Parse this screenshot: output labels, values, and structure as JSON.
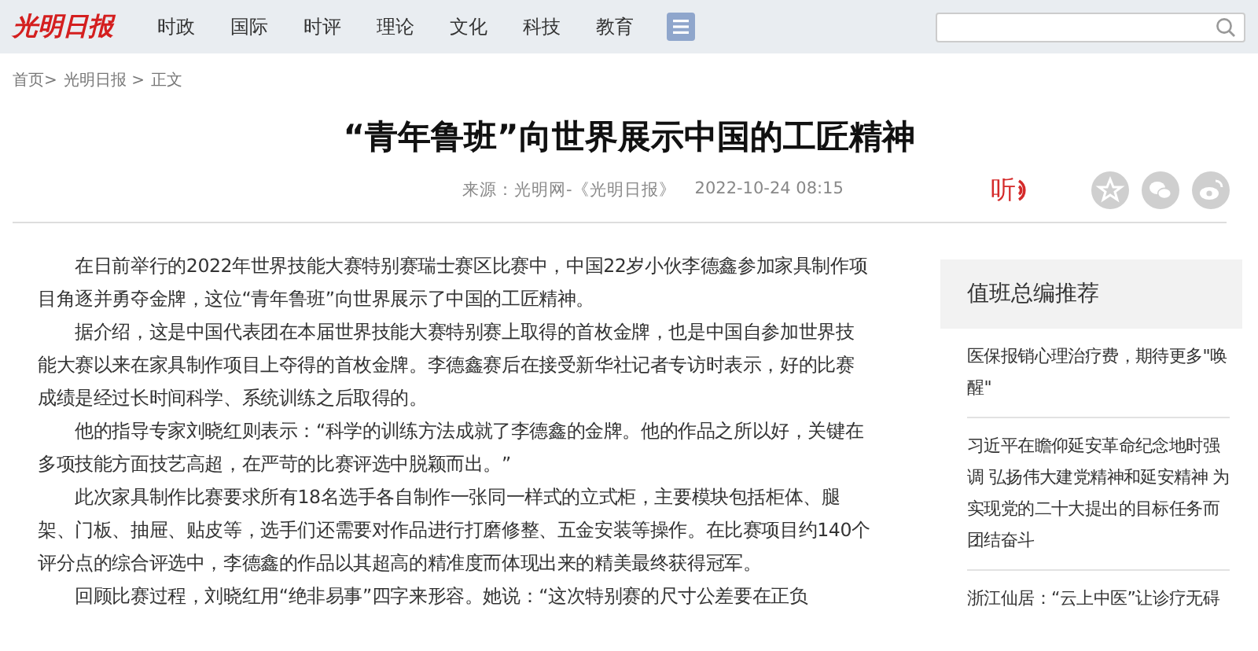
{
  "header": {
    "logo": "光明日报",
    "nav": [
      "时政",
      "国际",
      "时评",
      "理论",
      "文化",
      "科技",
      "教育"
    ]
  },
  "breadcrumb": [
    "首页>",
    "光明日报 >",
    "正文"
  ],
  "article": {
    "title": "“青年鲁班”向世界展示中国的工匠精神",
    "source": "来源：光明网-《光明日报》",
    "date": "2022-10-24 08:15",
    "listen_label": "听",
    "paragraphs": [
      "在日前举行的2022年世界技能大赛特别赛瑞士赛区比赛中，中国22岁小伙李德鑫参加家具制作项目角逐并勇夺金牌，这位“青年鲁班”向世界展示了中国的工匠精神。",
      "据介绍，这是中国代表团在本届世界技能大赛特别赛上取得的首枚金牌，也是中国自参加世界技能大赛以来在家具制作项目上夺得的首枚金牌。李德鑫赛后在接受新华社记者专访时表示，好的比赛成绩是经过长时间科学、系统训练之后取得的。",
      "他的指导专家刘晓红则表示：“科学的训练方法成就了李德鑫的金牌。他的作品之所以好，关键在多项技能方面技艺高超，在严苛的比赛评选中脱颖而出。”",
      "此次家具制作比赛要求所有18名选手各自制作一张同一样式的立式柜，主要模块包括柜体、腿架、门板、抽屉、贴皮等，选手们还需要对作品进行打磨修整、五金安装等操作。在比赛项目约140个评分点的综合评选中，李德鑫的作品以其超高的精准度而体现出来的精美最终获得冠军。",
      "回顾比赛过程，刘晓红用“绝非易事”四字来形容。她说：“这次特别赛的尺寸公差要在正负"
    ]
  },
  "sidebar": {
    "title": "值班总编推荐",
    "items": [
      "医保报销心理治疗费，期待更多\"唤醒\"",
      "习近平在瞻仰延安革命纪念地时强调 弘扬伟大建党精神和延安精神 为实现党的二十大提出的目标任务而团结奋斗",
      "浙江仙居：“云上中医”让诊疗无碍"
    ]
  }
}
